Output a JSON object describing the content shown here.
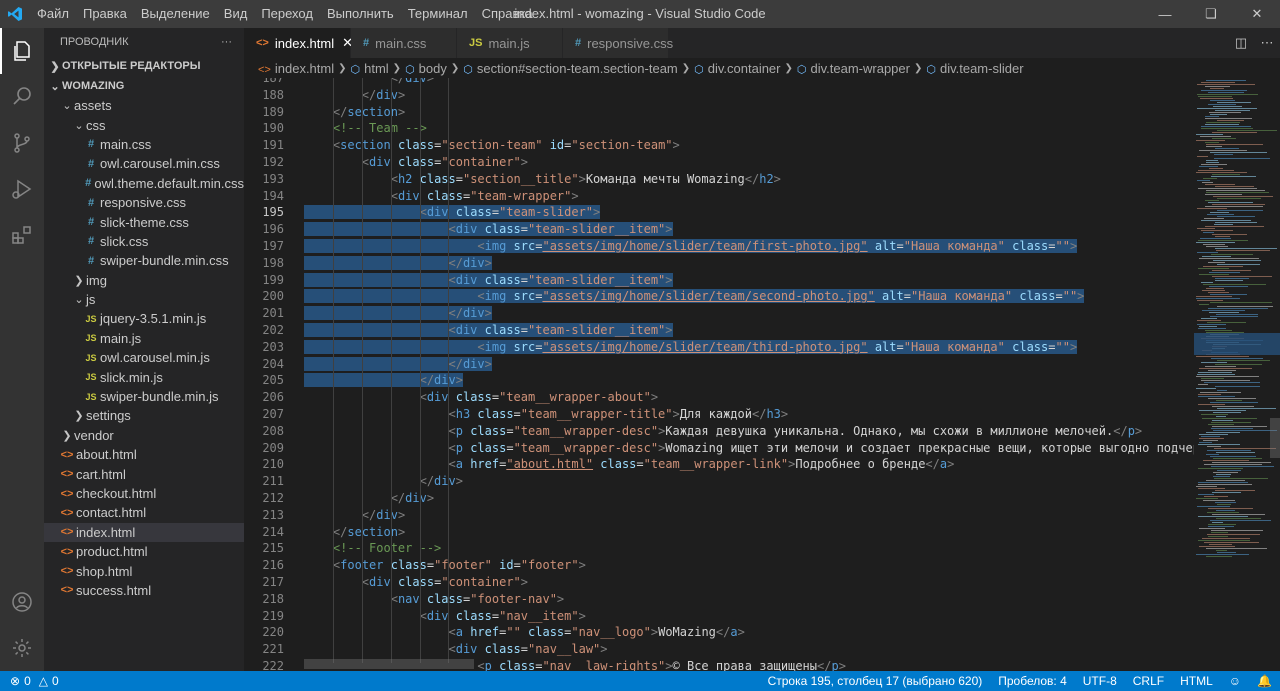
{
  "titlebar": {
    "menu": [
      "Файл",
      "Правка",
      "Выделение",
      "Вид",
      "Переход",
      "Выполнить",
      "Терминал",
      "Справка"
    ],
    "title": "index.html - womazing - Visual Studio Code"
  },
  "sidebar": {
    "header": "ПРОВОДНИК",
    "more": "···",
    "open_editors": "ОТКРЫТЫЕ РЕДАКТОРЫ",
    "root": "WOMAZING",
    "tree": [
      {
        "label": "assets",
        "kind": "folder-open",
        "depth": 1
      },
      {
        "label": "css",
        "kind": "folder-open",
        "depth": 2
      },
      {
        "label": "main.css",
        "kind": "css",
        "depth": 3
      },
      {
        "label": "owl.carousel.min.css",
        "kind": "css",
        "depth": 3
      },
      {
        "label": "owl.theme.default.min.css",
        "kind": "css",
        "depth": 3
      },
      {
        "label": "responsive.css",
        "kind": "css",
        "depth": 3
      },
      {
        "label": "slick-theme.css",
        "kind": "css",
        "depth": 3
      },
      {
        "label": "slick.css",
        "kind": "css",
        "depth": 3
      },
      {
        "label": "swiper-bundle.min.css",
        "kind": "css",
        "depth": 3
      },
      {
        "label": "img",
        "kind": "folder",
        "depth": 2
      },
      {
        "label": "js",
        "kind": "folder-open",
        "depth": 2
      },
      {
        "label": "jquery-3.5.1.min.js",
        "kind": "js",
        "depth": 3
      },
      {
        "label": "main.js",
        "kind": "js",
        "depth": 3
      },
      {
        "label": "owl.carousel.min.js",
        "kind": "js",
        "depth": 3
      },
      {
        "label": "slick.min.js",
        "kind": "js",
        "depth": 3
      },
      {
        "label": "swiper-bundle.min.js",
        "kind": "js",
        "depth": 3
      },
      {
        "label": "settings",
        "kind": "folder",
        "depth": 2
      },
      {
        "label": "vendor",
        "kind": "folder",
        "depth": 1
      },
      {
        "label": "about.html",
        "kind": "html",
        "depth": 1
      },
      {
        "label": "cart.html",
        "kind": "html",
        "depth": 1
      },
      {
        "label": "checkout.html",
        "kind": "html",
        "depth": 1
      },
      {
        "label": "contact.html",
        "kind": "html",
        "depth": 1
      },
      {
        "label": "index.html",
        "kind": "html",
        "depth": 1,
        "selected": true
      },
      {
        "label": "product.html",
        "kind": "html",
        "depth": 1
      },
      {
        "label": "shop.html",
        "kind": "html",
        "depth": 1
      },
      {
        "label": "success.html",
        "kind": "html",
        "depth": 1
      }
    ]
  },
  "tabs": [
    {
      "label": "index.html",
      "icon": "<>",
      "active": true
    },
    {
      "label": "main.css",
      "icon": "#",
      "active": false
    },
    {
      "label": "main.js",
      "icon": "JS",
      "active": false
    },
    {
      "label": "responsive.css",
      "icon": "#",
      "active": false
    }
  ],
  "breadcrumb": [
    "index.html",
    "html",
    "body",
    "section#section-team.section-team",
    "div.container",
    "div.team-wrapper",
    "div.team-slider"
  ],
  "editor": {
    "current_line": 195,
    "lines": [
      {
        "n": "187",
        "text": "            </div>"
      },
      {
        "n": "188",
        "text": "        </div>"
      },
      {
        "n": "189",
        "text": "    </section>"
      },
      {
        "n": "190",
        "text": "    <!-- Team -->"
      },
      {
        "n": "191",
        "text": "    <section class=\"section-team\" id=\"section-team\">"
      },
      {
        "n": "192",
        "text": "        <div class=\"container\">"
      },
      {
        "n": "193",
        "text": "            <h2 class=\"section__title\">Команда мечты Womazing</h2>"
      },
      {
        "n": "194",
        "text": "            <div class=\"team-wrapper\">"
      },
      {
        "n": "195",
        "text": "                <div class=\"team-slider\">"
      },
      {
        "n": "196",
        "text": "                    <div class=\"team-slider__item\">"
      },
      {
        "n": "197",
        "text": "                        <img src=\"assets/img/home/slider/team/first-photo.jpg\" alt=\"Наша команда\" class=\"\">"
      },
      {
        "n": "198",
        "text": "                    </div>"
      },
      {
        "n": "199",
        "text": "                    <div class=\"team-slider__item\">"
      },
      {
        "n": "200",
        "text": "                        <img src=\"assets/img/home/slider/team/second-photo.jpg\" alt=\"Наша команда\" class=\"\">"
      },
      {
        "n": "201",
        "text": "                    </div>"
      },
      {
        "n": "202",
        "text": "                    <div class=\"team-slider__item\">"
      },
      {
        "n": "203",
        "text": "                        <img src=\"assets/img/home/slider/team/third-photo.jpg\" alt=\"Наша команда\" class=\"\">"
      },
      {
        "n": "204",
        "text": "                    </div>"
      },
      {
        "n": "205",
        "text": "                </div>"
      },
      {
        "n": "206",
        "text": "                <div class=\"team__wrapper-about\">"
      },
      {
        "n": "207",
        "text": "                    <h3 class=\"team__wrapper-title\">Для каждой</h3>"
      },
      {
        "n": "208",
        "text": "                    <p class=\"team__wrapper-desc\">Каждая девушка уникальна. Однако, мы схожи в миллионе мелочей.</p>"
      },
      {
        "n": "209",
        "text": "                    <p class=\"team__wrapper-desc\">Womazing ищет эти мелочи и создает прекрасные вещи, которые выгодно подчеркивают"
      },
      {
        "n": "210",
        "text": "                    <a href=\"about.html\" class=\"team__wrapper-link\">Подробнее о бренде</a>"
      },
      {
        "n": "211",
        "text": "                </div>"
      },
      {
        "n": "212",
        "text": "            </div>"
      },
      {
        "n": "213",
        "text": "        </div>"
      },
      {
        "n": "214",
        "text": "    </section>"
      },
      {
        "n": "215",
        "text": "    <!-- Footer -->"
      },
      {
        "n": "216",
        "text": "    <footer class=\"footer\" id=\"footer\">"
      },
      {
        "n": "217",
        "text": "        <div class=\"container\">"
      },
      {
        "n": "218",
        "text": "            <nav class=\"footer-nav\">"
      },
      {
        "n": "219",
        "text": "                <div class=\"nav__item\">"
      },
      {
        "n": "220",
        "text": "                    <a href=\"\" class=\"nav__logo\">WoMazing</a>"
      },
      {
        "n": "221",
        "text": "                    <div class=\"nav__law\">"
      },
      {
        "n": "222",
        "text": "                        <p class=\"nav__law-rights\">© Все права защищены</p>"
      }
    ]
  },
  "status": {
    "errors": "0",
    "warnings": "0",
    "position": "Строка 195, столбец 17 (выбрано 620)",
    "spaces": "Пробелов: 4",
    "encoding": "UTF-8",
    "eol": "CRLF",
    "language": "HTML"
  },
  "colors": {
    "accent": "#007acc",
    "selection": "#264f78"
  }
}
